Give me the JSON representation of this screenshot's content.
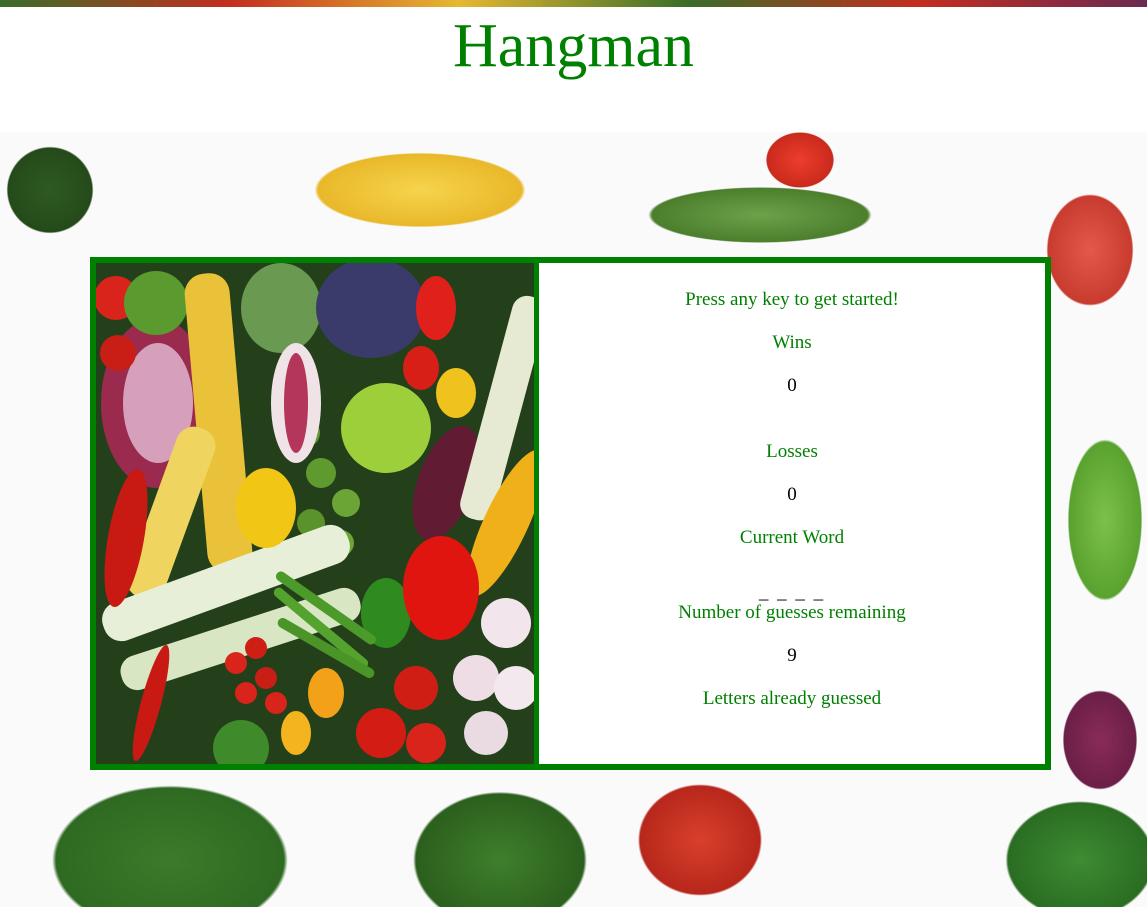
{
  "header": {
    "title": "Hangman"
  },
  "game": {
    "prompt": "Press any key to get started!",
    "wins_label": "Wins",
    "wins_value": "0",
    "losses_label": "Losses",
    "losses_value": "0",
    "current_word_label": "Current Word",
    "current_word_value": "_ _ _ _",
    "guesses_label": "Number of guesses remaining",
    "guesses_value": "9",
    "letters_guessed_label": "Letters already guessed",
    "letters_guessed_value": ""
  },
  "colors": {
    "accent": "#008000",
    "text": "#000000",
    "panel_background": "#ffffff"
  }
}
